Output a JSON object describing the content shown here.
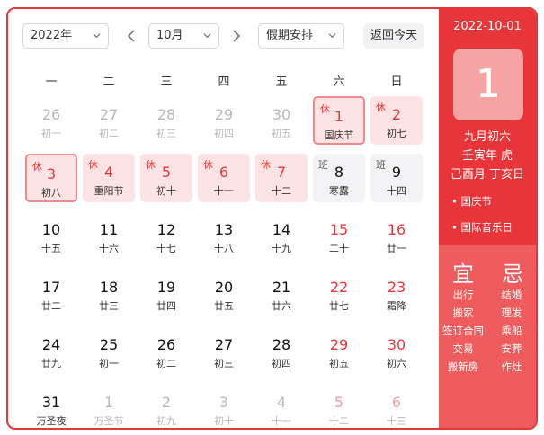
{
  "toolbar": {
    "year": "2022年",
    "month": "10月",
    "holiday": "假期安排",
    "today": "返回今天"
  },
  "weekdays": [
    "一",
    "二",
    "三",
    "四",
    "五",
    "六",
    "日"
  ],
  "days": [
    {
      "num": "26",
      "lunar": "初一",
      "state": "other"
    },
    {
      "num": "27",
      "lunar": "初二",
      "state": "other"
    },
    {
      "num": "28",
      "lunar": "初三",
      "state": "other"
    },
    {
      "num": "29",
      "lunar": "初四",
      "state": "other"
    },
    {
      "num": "30",
      "lunar": "初五",
      "state": "other"
    },
    {
      "num": "1",
      "lunar": "国庆节",
      "tag": "休",
      "state": "rest selected"
    },
    {
      "num": "2",
      "lunar": "初七",
      "tag": "休",
      "state": "rest"
    },
    {
      "num": "3",
      "lunar": "初八",
      "tag": "休",
      "state": "rest selected"
    },
    {
      "num": "4",
      "lunar": "重阳节",
      "tag": "休",
      "state": "rest"
    },
    {
      "num": "5",
      "lunar": "初十",
      "tag": "休",
      "state": "rest"
    },
    {
      "num": "6",
      "lunar": "十一",
      "tag": "休",
      "state": "rest"
    },
    {
      "num": "7",
      "lunar": "十二",
      "tag": "休",
      "state": "rest"
    },
    {
      "num": "8",
      "lunar": "寒露",
      "tag": "班",
      "state": "work"
    },
    {
      "num": "9",
      "lunar": "十四",
      "tag": "班",
      "state": "work"
    },
    {
      "num": "10",
      "lunar": "十五",
      "state": ""
    },
    {
      "num": "11",
      "lunar": "十六",
      "state": ""
    },
    {
      "num": "12",
      "lunar": "十七",
      "state": ""
    },
    {
      "num": "13",
      "lunar": "十八",
      "state": ""
    },
    {
      "num": "14",
      "lunar": "十九",
      "state": ""
    },
    {
      "num": "15",
      "lunar": "二十",
      "state": "weekend"
    },
    {
      "num": "16",
      "lunar": "廿一",
      "state": "weekend"
    },
    {
      "num": "17",
      "lunar": "廿二",
      "state": ""
    },
    {
      "num": "18",
      "lunar": "廿三",
      "state": ""
    },
    {
      "num": "19",
      "lunar": "廿四",
      "state": ""
    },
    {
      "num": "20",
      "lunar": "廿五",
      "state": ""
    },
    {
      "num": "21",
      "lunar": "廿六",
      "state": ""
    },
    {
      "num": "22",
      "lunar": "廿七",
      "state": "weekend"
    },
    {
      "num": "23",
      "lunar": "霜降",
      "state": "weekend"
    },
    {
      "num": "24",
      "lunar": "廿九",
      "state": ""
    },
    {
      "num": "25",
      "lunar": "初一",
      "state": ""
    },
    {
      "num": "26",
      "lunar": "初二",
      "state": ""
    },
    {
      "num": "27",
      "lunar": "初三",
      "state": ""
    },
    {
      "num": "28",
      "lunar": "初四",
      "state": ""
    },
    {
      "num": "29",
      "lunar": "初五",
      "state": "weekend"
    },
    {
      "num": "30",
      "lunar": "初六",
      "state": "weekend"
    },
    {
      "num": "31",
      "lunar": "万圣夜",
      "state": ""
    },
    {
      "num": "1",
      "lunar": "万圣节",
      "state": "other"
    },
    {
      "num": "2",
      "lunar": "初九",
      "state": "other"
    },
    {
      "num": "3",
      "lunar": "初十",
      "state": "other"
    },
    {
      "num": "4",
      "lunar": "十一",
      "state": "other"
    },
    {
      "num": "5",
      "lunar": "十二",
      "state": "other weekend"
    },
    {
      "num": "6",
      "lunar": "十三",
      "state": "other weekend"
    }
  ],
  "side": {
    "date": "2022-10-01",
    "day": "1",
    "lunar_date": "九月初六",
    "year_ganzhi": "壬寅年 虎",
    "month_day_ganzhi": "己酉月 丁亥日",
    "festivals": [
      "• 国庆节",
      "• 国际音乐日"
    ],
    "yi_title": "宜",
    "ji_title": "忌",
    "yi": [
      "出行",
      "搬家",
      "签订合同",
      "交易",
      "搬新房"
    ],
    "ji": [
      "结婚",
      "理发",
      "乘船",
      "安葬",
      "作灶"
    ]
  },
  "colors": {
    "accent": "#e6383a",
    "rest_bg": "#fde3e3",
    "work_bg": "#f3f3f5",
    "panel": "#e8353a",
    "panel_light": "#ef5c5d"
  }
}
